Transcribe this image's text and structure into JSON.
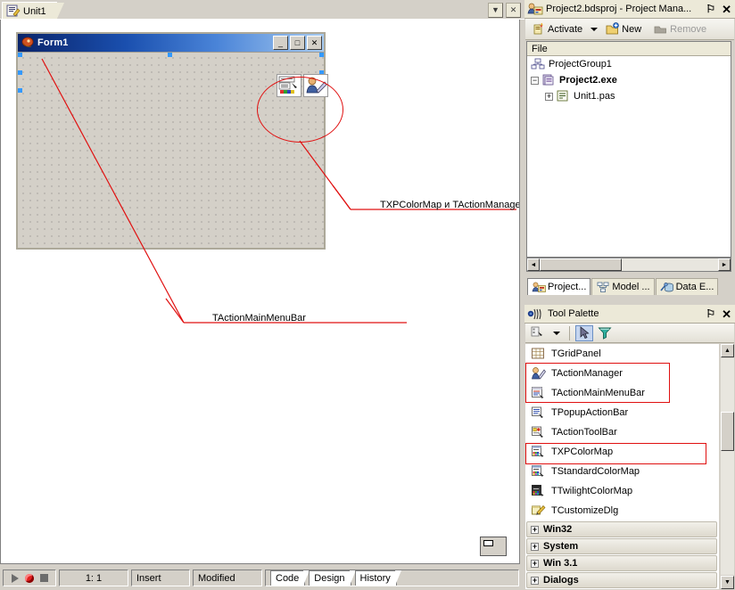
{
  "editor": {
    "tab_label": "Unit1",
    "tab_icon": "unit-file-icon",
    "tab_buttons": [
      {
        "name": "tab-list-dropdown",
        "glyph": "▼"
      },
      {
        "name": "tab-close",
        "glyph": "✕"
      }
    ],
    "form": {
      "title": "Form1",
      "icon": "delphi-form-icon",
      "window_buttons": [
        {
          "name": "minimize-button",
          "glyph": "_"
        },
        {
          "name": "maximize-button",
          "glyph": "□"
        },
        {
          "name": "close-button",
          "glyph": "✕"
        }
      ],
      "components": [
        {
          "name": "txpcolormap-component",
          "label": "TXPColorMap"
        },
        {
          "name": "tactionmanager-component",
          "label": "TActionManager"
        }
      ]
    },
    "annotations": [
      {
        "name": "annotation-components",
        "text": "TXPColorMap и TActionManager"
      },
      {
        "name": "annotation-mainmenubar",
        "text": "TActionMainMenuBar"
      }
    ],
    "status": {
      "cursor_position": "1:  1",
      "insert_mode": "Insert",
      "modified": "Modified",
      "view_tabs": [
        {
          "label": "Code",
          "active": true
        },
        {
          "label": "Design",
          "active": false
        },
        {
          "label": "History",
          "active": false
        }
      ],
      "run_buttons": [
        {
          "name": "run-button",
          "glyph": "play"
        },
        {
          "name": "pause-button",
          "glyph": "record"
        },
        {
          "name": "stop-button",
          "glyph": "stop"
        }
      ]
    }
  },
  "project_manager": {
    "title": "Project2.bdsproj - Project Mana...",
    "icon": "project-manager-icon",
    "pin_glyph": "⚐",
    "close_glyph": "✕",
    "toolbar": [
      {
        "name": "activate-button",
        "label": "Activate",
        "icon": "activate-icon",
        "disabled": false,
        "has_caret": true
      },
      {
        "name": "new-button",
        "label": "New",
        "icon": "new-folder-icon",
        "disabled": false,
        "has_caret": false
      },
      {
        "name": "remove-button",
        "label": "Remove",
        "icon": "remove-icon",
        "disabled": true,
        "has_caret": false
      }
    ],
    "column_header": "File",
    "tree": [
      {
        "name": "tree-node-projectgroup",
        "label": "ProjectGroup1",
        "icon": "project-group-icon",
        "indent": 0,
        "expander": "",
        "bold": false
      },
      {
        "name": "tree-node-project2exe",
        "label": "Project2.exe",
        "icon": "project-exe-icon",
        "indent": 1,
        "expander": "−",
        "bold": true
      },
      {
        "name": "tree-node-unit1pas",
        "label": "Unit1.pas",
        "icon": "unit-pas-icon",
        "indent": 2,
        "expander": "+",
        "bold": false
      }
    ],
    "hscroll": {
      "left_glyph": "◄",
      "right_glyph": "►"
    },
    "dock_tabs": [
      {
        "name": "dock-tab-project-manager",
        "label": "Project...",
        "icon": "project-manager-icon",
        "active": true
      },
      {
        "name": "dock-tab-model-view",
        "label": "Model ...",
        "icon": "model-view-icon",
        "active": false
      },
      {
        "name": "dock-tab-data-explorer",
        "label": "Data E...",
        "icon": "data-explorer-icon",
        "active": false
      }
    ]
  },
  "tool_palette": {
    "title": "Tool Palette",
    "icon": "tool-palette-icon",
    "pin_glyph": "⚐",
    "close_glyph": "✕",
    "toolbar": [
      {
        "name": "palette-options-button",
        "icon": "palette-options-icon",
        "has_caret": true,
        "selected": false
      },
      {
        "name": "pointer-tool-button",
        "icon": "arrow-pointer-icon",
        "has_caret": false,
        "selected": true
      },
      {
        "name": "filter-tool-button",
        "icon": "funnel-filter-icon",
        "has_caret": false,
        "selected": false
      }
    ],
    "items": [
      {
        "name": "palette-item-tgridpanel",
        "label": "TGridPanel",
        "icon": "grid-panel-icon",
        "highlighted": false
      },
      {
        "name": "palette-item-tactionmanager",
        "label": "TActionManager",
        "icon": "action-manager-icon",
        "highlighted": true
      },
      {
        "name": "palette-item-tactionmainmenubar",
        "label": "TActionMainMenuBar",
        "icon": "action-mainmenubar-icon",
        "highlighted": true
      },
      {
        "name": "palette-item-tpopupactionbar",
        "label": "TPopupActionBar",
        "icon": "popup-actionbar-icon",
        "highlighted": false
      },
      {
        "name": "palette-item-tactiontoolbar",
        "label": "TActionToolBar",
        "icon": "action-toolbar-icon",
        "highlighted": false
      },
      {
        "name": "palette-item-txpcolormap",
        "label": "TXPColorMap",
        "icon": "colormap-icon",
        "highlighted": true
      },
      {
        "name": "palette-item-tstandardcolormap",
        "label": "TStandardColorMap",
        "icon": "colormap-icon",
        "highlighted": false
      },
      {
        "name": "palette-item-ttwilightcolormap",
        "label": "TTwilightColorMap",
        "icon": "colormap-icon",
        "highlighted": false
      },
      {
        "name": "palette-item-tcustomizedlg",
        "label": "TCustomizeDlg",
        "icon": "customize-dlg-icon",
        "highlighted": false
      }
    ],
    "categories": [
      {
        "name": "palette-category-win32",
        "label": "Win32",
        "expander": "+"
      },
      {
        "name": "palette-category-system",
        "label": "System",
        "expander": "+"
      },
      {
        "name": "palette-category-win31",
        "label": "Win 3.1",
        "expander": "+"
      },
      {
        "name": "palette-category-dialogs",
        "label": "Dialogs",
        "expander": "+"
      }
    ],
    "vscroll": {
      "up_glyph": "▲",
      "down_glyph": "▼"
    }
  },
  "colors": {
    "accent_red": "#e01010",
    "titlebar_dark": "#0a246a",
    "titlebar_light": "#a6caf0",
    "chrome": "#d4d0c8",
    "panel": "#ece9d8",
    "selection_handle": "#3399ff"
  }
}
